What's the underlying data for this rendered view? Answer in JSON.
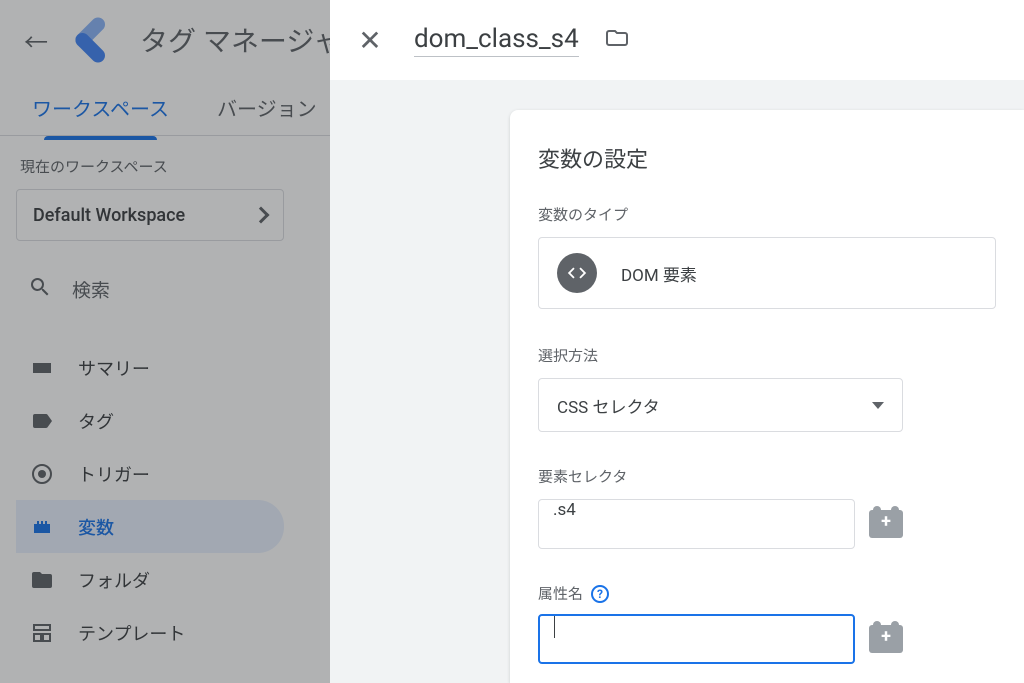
{
  "header": {
    "app_title": "タグ マネージャー"
  },
  "tabs": {
    "workspace": "ワークスペース",
    "versions": "バージョン"
  },
  "sidebar": {
    "ws_label": "現在のワークスペース",
    "ws_name": "Default Workspace",
    "search_placeholder": "検索",
    "items": [
      {
        "label": "サマリー"
      },
      {
        "label": "タグ"
      },
      {
        "label": "トリガー"
      },
      {
        "label": "変数"
      },
      {
        "label": "フォルダ"
      },
      {
        "label": "テンプレート"
      }
    ]
  },
  "panel": {
    "title": "dom_class_s4",
    "card_title": "変数の設定",
    "type_label": "変数のタイプ",
    "type_value": "DOM 要素",
    "select_method_label": "選択方法",
    "select_method_value": "CSS セレクタ",
    "element_selector_label": "要素セレクタ",
    "element_selector_value": ".s4",
    "attribute_label": "属性名",
    "attribute_value": ""
  }
}
